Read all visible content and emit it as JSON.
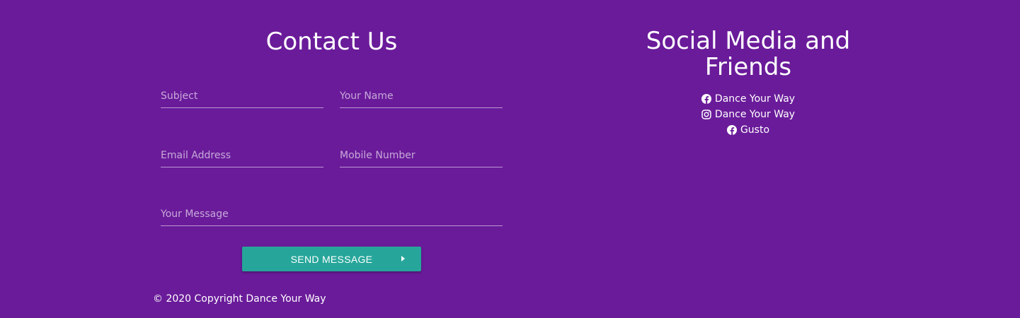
{
  "contact": {
    "title": "Contact Us",
    "fields": {
      "subject_placeholder": "Subject",
      "name_placeholder": "Your Name",
      "email_placeholder": "Email Address",
      "mobile_placeholder": "Mobile Number",
      "message_placeholder": "Your Message"
    },
    "send_button_label": "SEND MESSAGE",
    "send_button_icon": "caret-right-icon"
  },
  "social": {
    "title_line1": "Social Media and",
    "title_line2": "Friends",
    "links": [
      {
        "label": "Dance Your Way",
        "icon": "facebook-icon"
      },
      {
        "label": "Dance Your Way",
        "icon": "instagram-icon"
      },
      {
        "label": "Gusto",
        "icon": "facebook-icon"
      }
    ]
  },
  "footer": {
    "copyright": "© 2020 Copyright Dance Your Way"
  },
  "colors": {
    "background": "#6a1b9a",
    "button": "#26a69a",
    "text": "#ffffff"
  }
}
